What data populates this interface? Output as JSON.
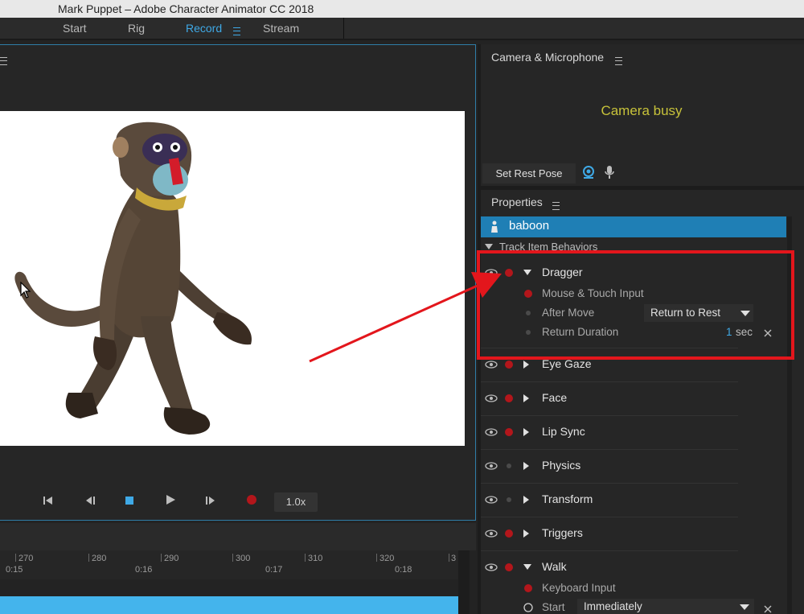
{
  "window": {
    "title": "Mark Puppet – Adobe Character Animator CC 2018"
  },
  "workspaces": [
    {
      "label": "Start"
    },
    {
      "label": "Rig"
    },
    {
      "label": "Record"
    },
    {
      "label": "Stream"
    }
  ],
  "scene": {
    "transport": {
      "speed": "1.0x"
    }
  },
  "timeline": {
    "frame_ticks": [
      "270",
      "280",
      "290",
      "300",
      "310",
      "320",
      "3"
    ],
    "time_labels": [
      "0:15",
      "0:16",
      "0:17",
      "0:18"
    ]
  },
  "camera_panel": {
    "title": "Camera & Microphone",
    "status": "Camera busy",
    "rest_pose_button": "Set Rest Pose"
  },
  "properties": {
    "title": "Properties",
    "puppet": "baboon",
    "section": "Track Item Behaviors",
    "dragger": {
      "name": "Dragger",
      "params": {
        "input": "Mouse & Touch Input",
        "after_move_label": "After Move",
        "after_move_value": "Return to Rest",
        "return_duration_label": "Return Duration",
        "return_duration_value": "1",
        "return_duration_unit": "sec"
      }
    },
    "behaviors": [
      "Eye Gaze",
      "Face",
      "Lip Sync",
      "Physics",
      "Transform",
      "Triggers"
    ],
    "walk": {
      "name": "Walk",
      "input": "Keyboard Input",
      "start_label": "Start",
      "start_value": "Immediately"
    }
  },
  "colors": {
    "accent": "#3fa9e6",
    "selection": "#1f7fb5",
    "record_red": "#b3161b",
    "camera_status": "#c7c23a",
    "annotation_red": "#e3161c"
  }
}
